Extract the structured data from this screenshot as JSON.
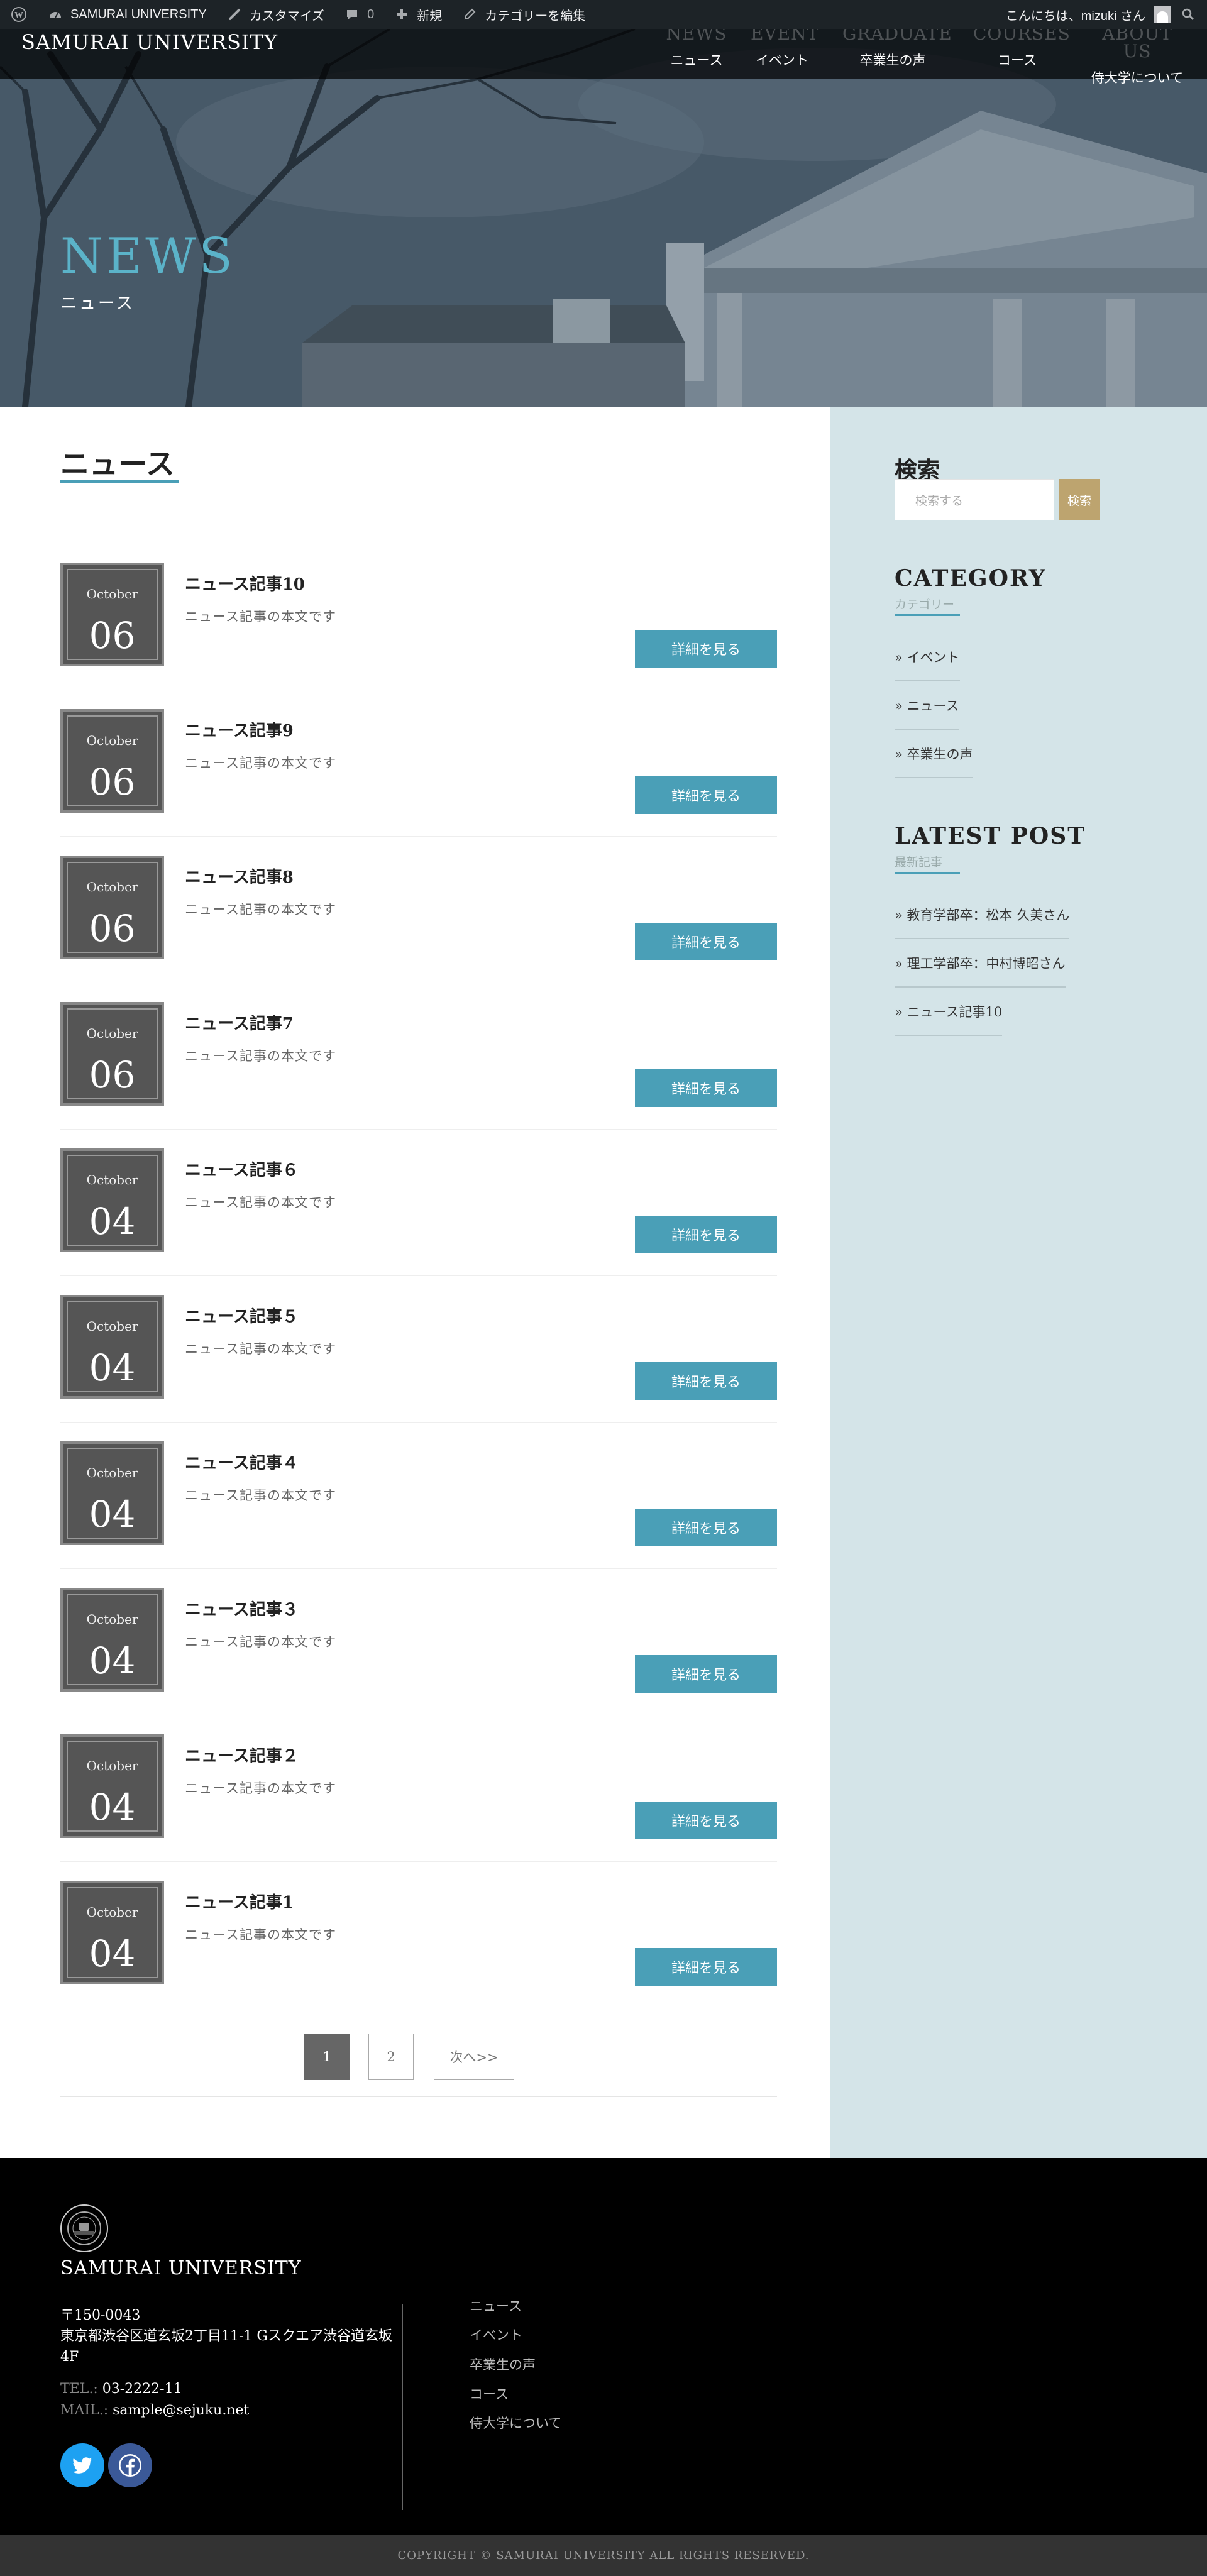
{
  "admin_bar": {
    "site_name": "SAMURAI UNIVERSITY",
    "customize": "カスタマイズ",
    "comments_count": "0",
    "new": "新規",
    "edit_category": "カテゴリーを編集",
    "greeting": "こんにちは、mizuki さん"
  },
  "header": {
    "logo": "SAMURAI UNIVERSITY",
    "nav": [
      {
        "en": "NEWS",
        "ja": "ニュース"
      },
      {
        "en": "EVENT",
        "ja": "イベント"
      },
      {
        "en": "GRADUATE",
        "ja": "卒業生の声"
      },
      {
        "en": "COURSES",
        "ja": "コース"
      },
      {
        "en": "ABOUT US",
        "ja": "侍大学について"
      }
    ]
  },
  "hero": {
    "title": "NEWS",
    "subtitle": "ニュース"
  },
  "main": {
    "heading": "ニュース",
    "more_label": "詳細を見る",
    "posts": [
      {
        "month": "October",
        "day": "06",
        "title": "ニュース記事10",
        "excerpt": "ニュース記事の本文です"
      },
      {
        "month": "October",
        "day": "06",
        "title": "ニュース記事9",
        "excerpt": "ニュース記事の本文です"
      },
      {
        "month": "October",
        "day": "06",
        "title": "ニュース記事8",
        "excerpt": "ニュース記事の本文です"
      },
      {
        "month": "October",
        "day": "06",
        "title": "ニュース記事7",
        "excerpt": "ニュース記事の本文です"
      },
      {
        "month": "October",
        "day": "04",
        "title": "ニュース記事６",
        "excerpt": "ニュース記事の本文です"
      },
      {
        "month": "October",
        "day": "04",
        "title": "ニュース記事５",
        "excerpt": "ニュース記事の本文です"
      },
      {
        "month": "October",
        "day": "04",
        "title": "ニュース記事４",
        "excerpt": "ニュース記事の本文です"
      },
      {
        "month": "October",
        "day": "04",
        "title": "ニュース記事３",
        "excerpt": "ニュース記事の本文です"
      },
      {
        "month": "October",
        "day": "04",
        "title": "ニュース記事２",
        "excerpt": "ニュース記事の本文です"
      },
      {
        "month": "October",
        "day": "04",
        "title": "ニュース記事1",
        "excerpt": "ニュース記事の本文です"
      }
    ],
    "pagination": {
      "pages": [
        "1",
        "2"
      ],
      "current": "1",
      "next": "次へ>>"
    }
  },
  "sidebar": {
    "search_heading": "検索",
    "search_placeholder": "検索する",
    "search_button": "検索",
    "category_heading": "CATEGORY",
    "category_sub": "カテゴリー",
    "categories": [
      "» イベント",
      "» ニュース",
      "» 卒業生の声"
    ],
    "latest_heading": "LATEST POST",
    "latest_sub": "最新記事",
    "latest": [
      "» 教育学部卒：松本 久美さん",
      "» 理工学部卒：中村博昭さん",
      "» ニュース記事10"
    ]
  },
  "footer": {
    "name": "SAMURAI UNIVERSITY",
    "postal": "〒150-0043",
    "address": "東京都渋谷区道玄坂2丁目11-1 Gスクエア渋谷道玄坂4F",
    "tel_label": "TEL.:",
    "tel": "03-2222-11",
    "mail_label": "MAIL.:",
    "mail": "sample@sejuku.net",
    "links": [
      "ニュース",
      "イベント",
      "卒業生の声",
      "コース",
      "侍大学について"
    ],
    "copyright": "COPYRIGHT © SAMURAI UNIVERSITY ALL RIGHTS RESERVED."
  },
  "colors": {
    "accent": "#4a9fb7",
    "sidebar_bg": "#d4e4e8",
    "search_button": "#bda46f",
    "twitter": "#1da1f2",
    "facebook": "#3b5998"
  }
}
